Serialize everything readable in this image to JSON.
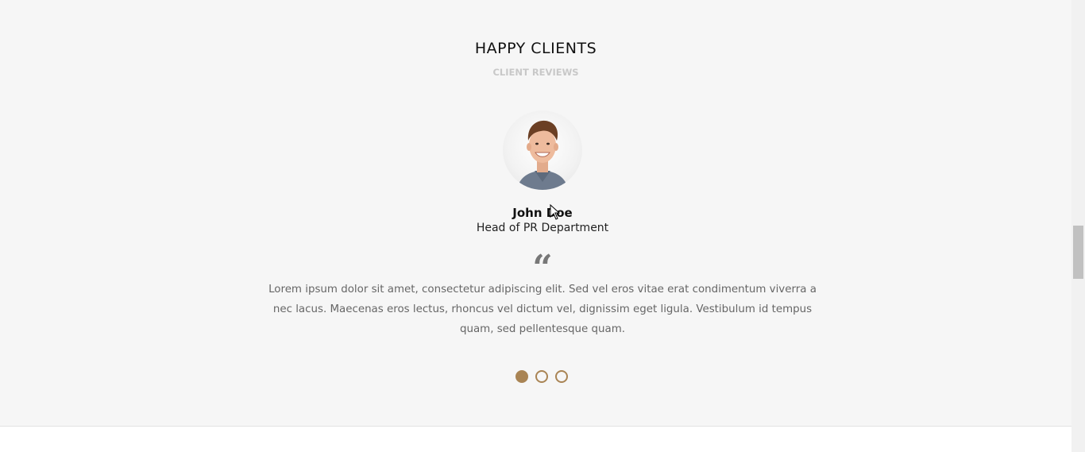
{
  "section": {
    "title": "HAPPY CLIENTS",
    "subtitle": "CLIENT REVIEWS"
  },
  "testimonial": {
    "name": "John Doe",
    "role": "Head of PR Department",
    "quote_icon": "quote-icon",
    "quote_glyph": "“",
    "text": "Lorem ipsum dolor sit amet, consectetur adipiscing elit. Sed vel eros vitae erat condimentum viverra a nec lacus. Maecenas eros lectus, rhoncus vel dictum vel, dignissim eget ligula. Vestibulum id tempus quam, sed pellentesque quam."
  },
  "carousel": {
    "active_index": 0,
    "dots": 3
  },
  "colors": {
    "accent": "#a98454",
    "section_bg": "#f6f6f6"
  }
}
